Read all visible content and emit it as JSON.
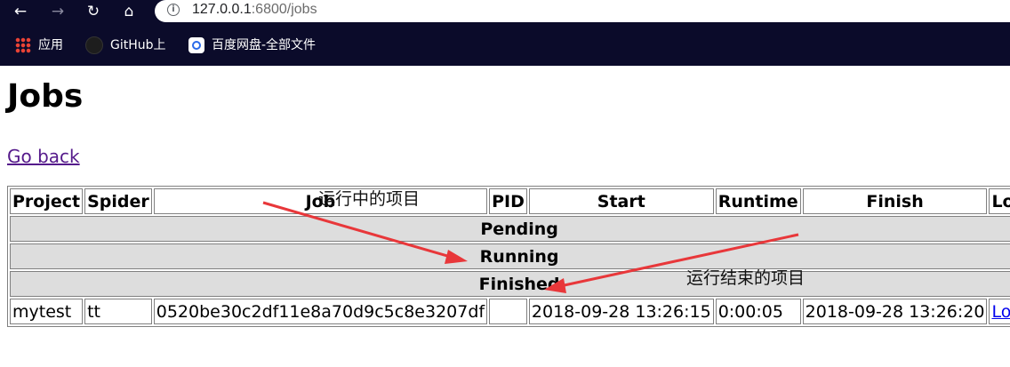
{
  "browser": {
    "nav": {
      "back": "←",
      "forward": "→",
      "reload": "↻",
      "home": "⌂"
    },
    "url": {
      "host": "127.0.0.1",
      "rest": ":6800/jobs"
    },
    "bookmarks": [
      "应用",
      "GitHub上",
      "百度网盘-全部文件"
    ]
  },
  "page": {
    "title": "Jobs",
    "back_link": "Go back"
  },
  "table": {
    "headers": [
      "Project",
      "Spider",
      "Job",
      "PID",
      "Start",
      "Runtime",
      "Finish",
      "Log"
    ],
    "sections": {
      "pending": "Pending",
      "running": "Running",
      "finished": "Finished"
    },
    "finished_rows": [
      {
        "project": "mytest",
        "spider": "tt",
        "job": "0520be30c2df11e8a70d9c5c8e3207df",
        "pid": "",
        "start": "2018-09-28 13:26:15",
        "runtime": "0:00:05",
        "finish": "2018-09-28 13:26:20",
        "log": "Log"
      }
    ]
  },
  "annotations": {
    "running_note": "运行中的项目",
    "finished_note": "运行结束的项目",
    "arrow_color": "#e8373a"
  }
}
